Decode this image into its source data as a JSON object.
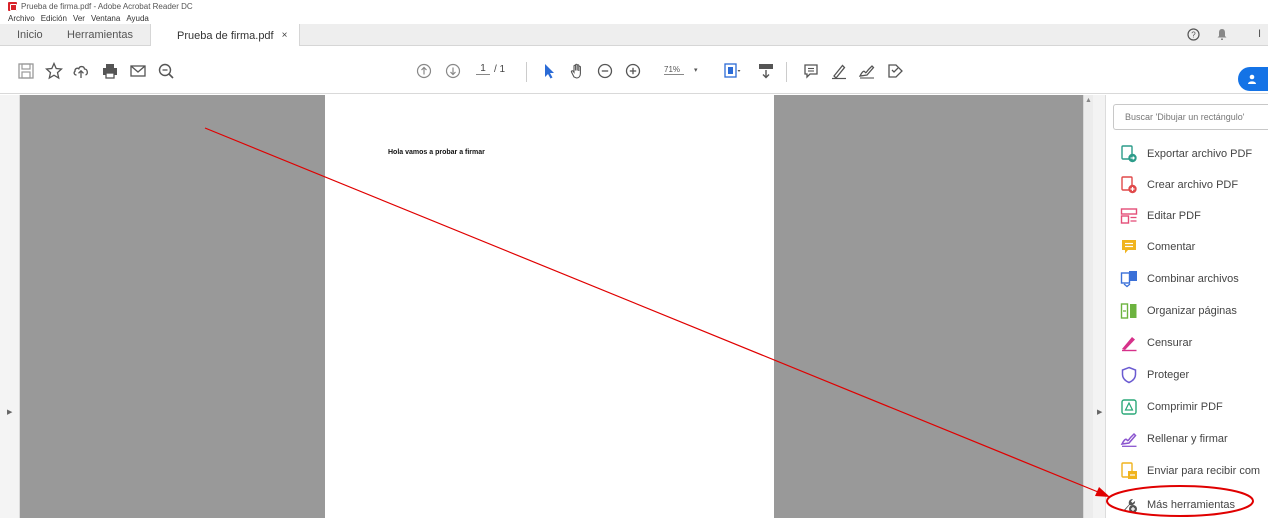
{
  "window": {
    "title": "Prueba de firma.pdf - Adobe Acrobat Reader DC"
  },
  "menu": [
    "Archivo",
    "Edición",
    "Ver",
    "Ventana",
    "Ayuda"
  ],
  "tabs": {
    "home": "Inicio",
    "tools": "Herramientas",
    "document": "Prueba de firma.pdf",
    "close": "×",
    "right_cut": "I"
  },
  "toolbar": {
    "page_current": "1",
    "page_total": "/ 1",
    "zoom": "71%",
    "zoom_caret": "▾"
  },
  "document": {
    "text": "Hola vamos a probar a firmar"
  },
  "search": {
    "placeholder": "Buscar 'Dibujar un rectángulo'"
  },
  "tools": [
    {
      "label": "Exportar archivo PDF",
      "icon": "export-pdf-icon",
      "color": "#2c9c8a"
    },
    {
      "label": "Crear archivo PDF",
      "icon": "create-pdf-icon",
      "color": "#e0494a"
    },
    {
      "label": "Editar PDF",
      "icon": "edit-pdf-icon",
      "color": "#e44e78"
    },
    {
      "label": "Comentar",
      "icon": "comment-icon",
      "color": "#f0b41f"
    },
    {
      "label": "Combinar archivos",
      "icon": "combine-icon",
      "color": "#3a70d8"
    },
    {
      "label": "Organizar páginas",
      "icon": "organize-icon",
      "color": "#6cb33f"
    },
    {
      "label": "Censurar",
      "icon": "redact-icon",
      "color": "#d6318a"
    },
    {
      "label": "Proteger",
      "icon": "protect-icon",
      "color": "#6b5bd1"
    },
    {
      "label": "Comprimir PDF",
      "icon": "compress-icon",
      "color": "#2aa878"
    },
    {
      "label": "Rellenar y firmar",
      "icon": "fill-sign-icon",
      "color": "#8b55cf"
    },
    {
      "label": "Enviar para recibir com",
      "icon": "send-comments-icon",
      "color": "#f0b41f"
    },
    {
      "label": "Más herramientas",
      "icon": "more-tools-icon",
      "color": "#555555"
    }
  ],
  "annotation": {
    "color": "#e00000"
  }
}
